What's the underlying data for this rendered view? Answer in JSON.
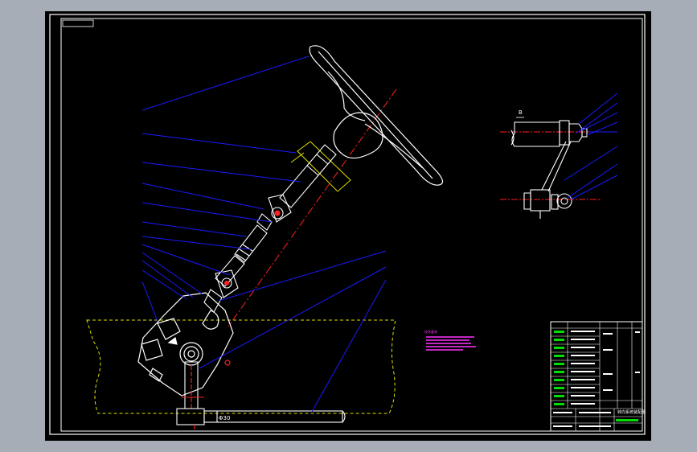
{
  "viewport": {
    "background": "#000000",
    "frame_color": "#ffffff",
    "leader_color": "#1a1aff",
    "centerline_color": "#ff2020",
    "dashed_color": "#e0e000",
    "text_green": "#00e000",
    "text_magenta": "#ff33ff"
  },
  "drawing": {
    "main_view": {
      "parts": [
        "steering-wheel",
        "steering-column",
        "upper-universal-joint",
        "intermediate-shaft",
        "lower-universal-joint",
        "steering-gear-box",
        "pitman-arm",
        "drag-link"
      ]
    },
    "detail_view": {
      "callout": "B"
    },
    "dimension_label": "Φ30"
  },
  "title_block": {
    "title": "转向系统装配图"
  }
}
